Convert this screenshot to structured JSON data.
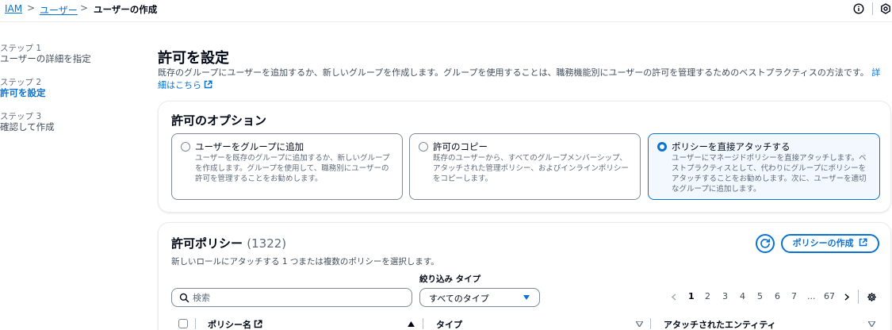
{
  "breadcrumb": {
    "items": [
      "IAM",
      "ユーザー",
      "ユーザーの作成"
    ],
    "separator": ">"
  },
  "header_icons": [
    "info-icon",
    "settings-icon"
  ],
  "steps": [
    {
      "num": "ステップ 1",
      "label": "ユーザーの詳細を指定",
      "active": false
    },
    {
      "num": "ステップ 2",
      "label": "許可を設定",
      "active": true
    },
    {
      "num": "ステップ 3",
      "label": "確認して作成",
      "active": false
    }
  ],
  "page": {
    "title": "許可を設定",
    "description": "既存のグループにユーザーを追加するか、新しいグループを作成します。グループを使用することは、職務機能別にユーザーの許可を管理するためのベストプラクティスの方法です。",
    "learn_more_line1": "詳細",
    "learn_more_line2": "はこちら"
  },
  "permission_options": {
    "heading": "許可のオプション",
    "options": [
      {
        "title": "ユーザーをグループに追加",
        "desc": [
          "ユーザーを既存のグループに追加するか、新しいグループ",
          "を作成します。グループを使用して、職務別にユーザーの",
          "許可を管理することをお勧めします。"
        ],
        "selected": false
      },
      {
        "title": "許可のコピー",
        "desc": [
          "既存のユーザーから、すべてのグループメンバーシップ、",
          "アタッチされた管理ポリシー、およびインラインポリシー",
          "をコピーします。"
        ],
        "selected": false
      },
      {
        "title": "ポリシーを直接アタッチする",
        "desc": [
          "ユーザーにマネージドポリシーを直接アタッチします。ベ",
          "ストプラクティスとして、代わりにグループにポリシーを",
          "アタッチすることをお勧めします。次に、ユーザーを適切",
          "なグループに追加します。"
        ],
        "selected": true
      }
    ]
  },
  "policies": {
    "heading": "許可ポリシー",
    "count": "(1322)",
    "subtext": "新しいロールにアタッチする 1 つまたは複数のポリシーを選択します。",
    "create_button": "ポリシーの作成",
    "filter_type_label": "絞り込み タイプ",
    "search_placeholder": "検索",
    "filter_selected": "すべてのタイプ",
    "pagination": {
      "pages": [
        "1",
        "2",
        "3",
        "4",
        "5",
        "6",
        "7",
        "...",
        "67"
      ],
      "current": "1"
    },
    "columns": [
      "ポリシー名",
      "タイプ",
      "アタッチされたエンティティ"
    ]
  },
  "colors": {
    "accent": "#0972d3",
    "text": "#000716",
    "muted": "#5f6b7a",
    "border": "#7d8998",
    "selected_bg": "#f2f8fd"
  }
}
